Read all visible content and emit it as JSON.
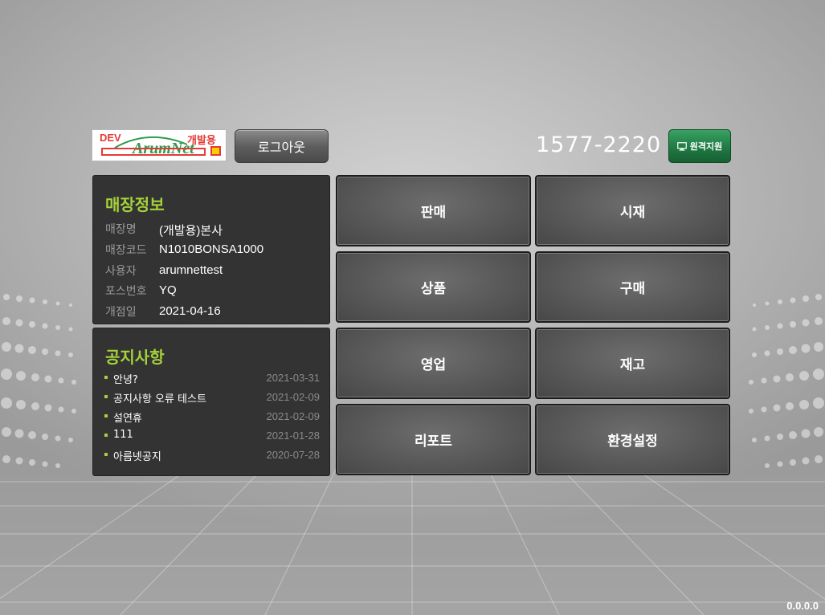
{
  "header": {
    "logo": {
      "tag_left": "DEV",
      "tag_right": "개발용",
      "brand_text": "ArumNet"
    },
    "logout_label": "로그아웃",
    "phone": "1577-2220",
    "remote_support_label": "원격지원",
    "remote_support_icon": "monitor-icon"
  },
  "store_info": {
    "title": "매장정보",
    "rows": [
      {
        "label": "매장명",
        "value": "(개발용)본사"
      },
      {
        "label": "매장코드",
        "value": "N1010BONSA1000"
      },
      {
        "label": "사용자",
        "value": "arumnettest"
      },
      {
        "label": "포스번호",
        "value": "YQ"
      },
      {
        "label": "개점일",
        "value": "2021-04-16"
      }
    ]
  },
  "notices": {
    "title": "공지사항",
    "items": [
      {
        "text": "안녕?",
        "date": "2021-03-31"
      },
      {
        "text": "공지사항 오류 테스트",
        "date": "2021-02-09"
      },
      {
        "text": "설연휴",
        "date": "2021-02-09"
      },
      {
        "text": "111",
        "date": "2021-01-28"
      },
      {
        "text": "아름넷공지",
        "date": "2020-07-28"
      }
    ]
  },
  "menu": {
    "sales": "판매",
    "cash": "시재",
    "products": "상품",
    "purchase": "구매",
    "business": "영업",
    "inventory": "재고",
    "report": "리포트",
    "settings": "환경설정"
  },
  "version": "0.0.0.0",
  "colors": {
    "accent_green": "#a5d13a",
    "remote_button": "#1f7a43",
    "panel_bg": "#333333",
    "logo_red": "#e53935"
  }
}
